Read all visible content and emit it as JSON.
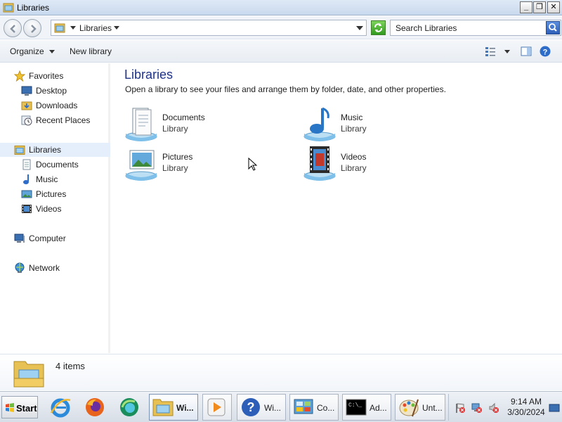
{
  "window": {
    "title": "Libraries"
  },
  "titlebar_buttons": {
    "minimize": "_",
    "restore": "❐",
    "close": "✕"
  },
  "address": {
    "crumb": "Libraries"
  },
  "search": {
    "placeholder": "Search Libraries"
  },
  "commands": {
    "organize": "Organize",
    "new_library": "New library"
  },
  "navigation": {
    "favorites": {
      "label": "Favorites",
      "items": [
        {
          "label": "Desktop",
          "icon": "desktop-icon"
        },
        {
          "label": "Downloads",
          "icon": "downloads-folder-icon"
        },
        {
          "label": "Recent Places",
          "icon": "recent-places-icon"
        }
      ]
    },
    "libraries": {
      "label": "Libraries",
      "items": [
        {
          "label": "Documents",
          "icon": "documents-icon"
        },
        {
          "label": "Music",
          "icon": "music-icon"
        },
        {
          "label": "Pictures",
          "icon": "pictures-icon"
        },
        {
          "label": "Videos",
          "icon": "videos-icon"
        }
      ]
    },
    "computer": {
      "label": "Computer"
    },
    "network": {
      "label": "Network"
    }
  },
  "content": {
    "heading": "Libraries",
    "subtitle": "Open a library to see your files and arrange them by folder, date, and other properties.",
    "libraries": [
      {
        "name": "Documents",
        "kind": "Library",
        "icon": "documents-library-icon"
      },
      {
        "name": "Music",
        "kind": "Library",
        "icon": "music-library-icon"
      },
      {
        "name": "Pictures",
        "kind": "Library",
        "icon": "pictures-library-icon"
      },
      {
        "name": "Videos",
        "kind": "Library",
        "icon": "videos-library-icon"
      }
    ]
  },
  "details": {
    "count": "4 items"
  },
  "taskbar": {
    "start": "Start",
    "quick_launch": [
      "internet-explorer-icon",
      "firefox-icon",
      "edge-icon"
    ],
    "buttons": [
      {
        "label": "Wi...",
        "icon": "libraries-folder-icon",
        "active": true
      },
      {
        "label": "",
        "icon": "media-player-icon",
        "active": false
      },
      {
        "label": "Wi...",
        "icon": "help-icon",
        "active": false
      },
      {
        "label": "Co...",
        "icon": "control-panel-icon",
        "active": false
      },
      {
        "label": "Ad...",
        "icon": "command-prompt-icon",
        "active": false
      },
      {
        "label": "Unt...",
        "icon": "paint-icon",
        "active": false
      }
    ],
    "clock": {
      "time": "9:14 AM",
      "date": "3/30/2024"
    }
  }
}
